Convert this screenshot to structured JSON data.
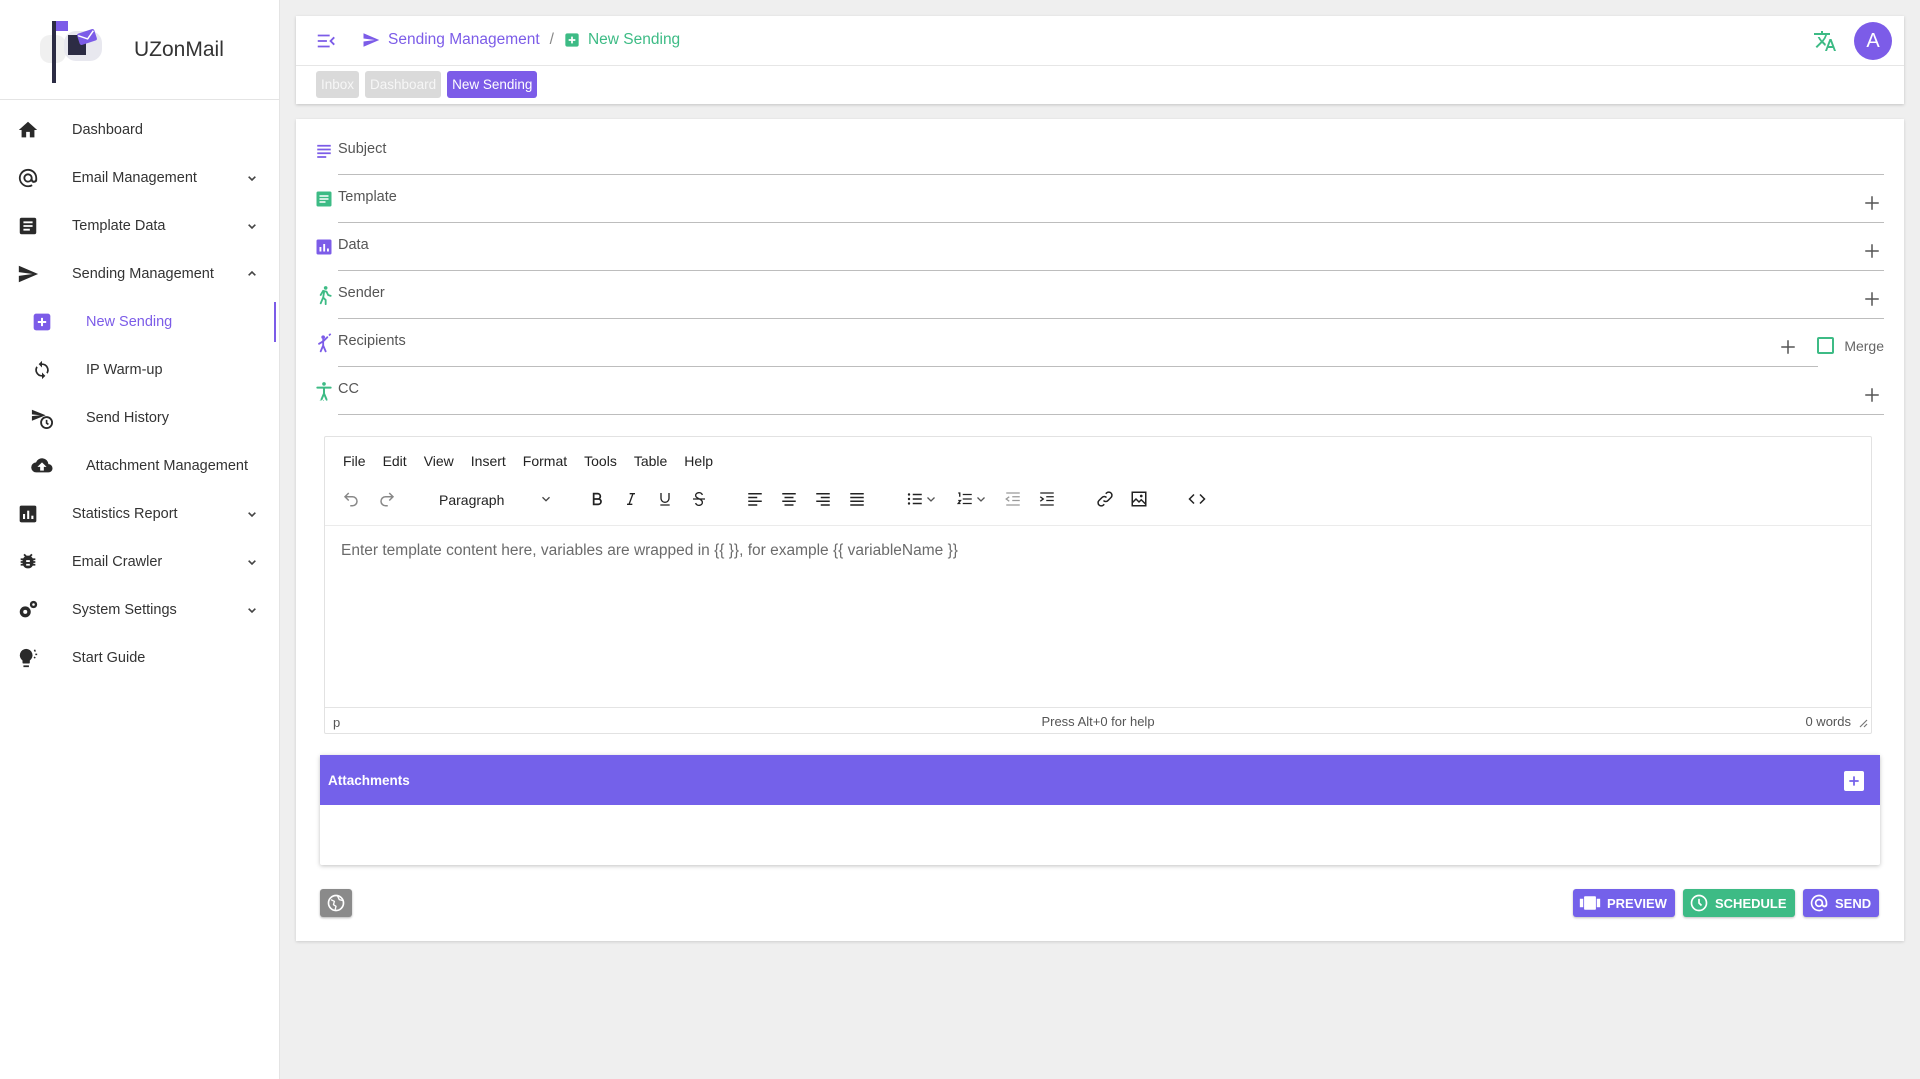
{
  "app": {
    "name": "UZonMail"
  },
  "sidebar": {
    "items": [
      {
        "label": "Dashboard",
        "icon": "home-icon",
        "chevron": ""
      },
      {
        "label": "Email Management",
        "icon": "at-icon",
        "chevron": "down"
      },
      {
        "label": "Template Data",
        "icon": "document-icon",
        "chevron": "down"
      },
      {
        "label": "Sending Management",
        "icon": "send-icon",
        "chevron": "up"
      },
      {
        "label": "New Sending",
        "icon": "plus-box-icon",
        "sub": true,
        "active": true
      },
      {
        "label": "IP Warm-up",
        "icon": "refresh-icon",
        "sub": true
      },
      {
        "label": "Send History",
        "icon": "send-clock-icon",
        "sub": true
      },
      {
        "label": "Attachment Management",
        "icon": "cloud-upload-icon",
        "sub": true
      },
      {
        "label": "Statistics Report",
        "icon": "chart-icon",
        "chevron": "down"
      },
      {
        "label": "Email Crawler",
        "icon": "bug-icon",
        "chevron": "down"
      },
      {
        "label": "System Settings",
        "icon": "gears-icon",
        "chevron": "down"
      },
      {
        "label": "Start Guide",
        "icon": "lightbulb-icon",
        "chevron": ""
      }
    ]
  },
  "header": {
    "breadcrumb": {
      "parent": "Sending Management",
      "separator": "/",
      "current": "New Sending"
    },
    "avatar_letter": "A",
    "tabs": [
      {
        "label": "Inbox",
        "active": false
      },
      {
        "label": "Dashboard",
        "active": false
      },
      {
        "label": "New Sending",
        "active": true
      }
    ]
  },
  "form": {
    "fields": [
      {
        "label": "Subject",
        "icon": "subject-lines-icon",
        "add": false
      },
      {
        "label": "Template",
        "icon": "template-icon",
        "add": true
      },
      {
        "label": "Data",
        "icon": "data-chart-icon",
        "add": true
      },
      {
        "label": "Sender",
        "icon": "sender-walk-icon",
        "add": true
      },
      {
        "label": "Recipients",
        "icon": "recipients-icon",
        "add": true,
        "merge": "Merge"
      },
      {
        "label": "CC",
        "icon": "cc-person-icon",
        "add": true
      }
    ]
  },
  "editor": {
    "menus": [
      "File",
      "Edit",
      "View",
      "Insert",
      "Format",
      "Tools",
      "Table",
      "Help"
    ],
    "block_format": "Paragraph",
    "placeholder": "Enter template content here, variables are wrapped in {{ }}, for example {{ variableName }}",
    "status": {
      "path": "p",
      "help": "Press Alt+0 for help",
      "words": "0 words"
    }
  },
  "attachments": {
    "title": "Attachments"
  },
  "actions": {
    "preview": "PREVIEW",
    "schedule": "SCHEDULE",
    "send": "SEND"
  },
  "colors": {
    "accent": "#7c5ce8",
    "attach_header": "#7461ea",
    "green": "#3dbb85"
  }
}
